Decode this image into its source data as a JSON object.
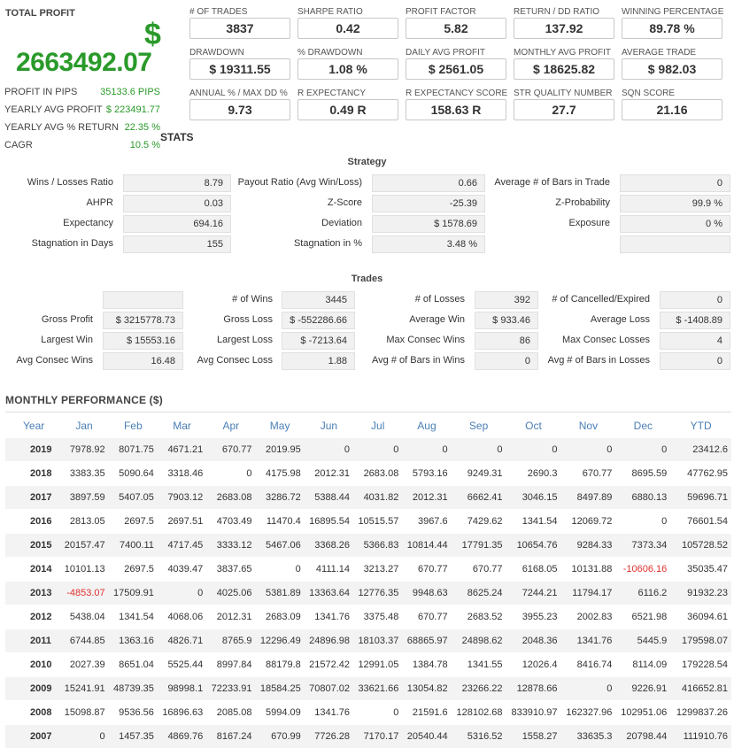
{
  "total_profit": {
    "title": "TOTAL PROFIT",
    "currency_symbol": "$",
    "value": "2663492.07",
    "rows": [
      {
        "label": "PROFIT IN PIPS",
        "value": "35133.6 PIPS"
      },
      {
        "label": "YEARLY AVG PROFIT",
        "value": "$ 223491.77"
      },
      {
        "label": "YEARLY AVG % RETURN",
        "value": "22.35 %"
      },
      {
        "label": "CAGR",
        "value": "10.5 %"
      }
    ]
  },
  "metrics": [
    {
      "label": "# OF TRADES",
      "value": "3837"
    },
    {
      "label": "SHARPE RATIO",
      "value": "0.42"
    },
    {
      "label": "PROFIT FACTOR",
      "value": "5.82"
    },
    {
      "label": "RETURN / DD RATIO",
      "value": "137.92"
    },
    {
      "label": "WINNING PERCENTAGE",
      "value": "89.78 %"
    },
    {
      "label": "DRAWDOWN",
      "value": "$ 19311.55"
    },
    {
      "label": "% DRAWDOWN",
      "value": "1.08 %"
    },
    {
      "label": "DAILY AVG PROFIT",
      "value": "$ 2561.05"
    },
    {
      "label": "MONTHLY AVG PROFIT",
      "value": "$ 18625.82"
    },
    {
      "label": "AVERAGE TRADE",
      "value": "$ 982.03"
    },
    {
      "label": "ANNUAL % / MAX DD %",
      "value": "9.73"
    },
    {
      "label": "R EXPECTANCY",
      "value": "0.49 R"
    },
    {
      "label": "R EXPECTANCY SCORE",
      "value": "158.63 R"
    },
    {
      "label": "STR QUALITY NUMBER",
      "value": "27.7"
    },
    {
      "label": "SQN SCORE",
      "value": "21.16"
    }
  ],
  "stats_heading": "STATS",
  "strategy": {
    "title": "Strategy",
    "rows": [
      [
        {
          "label": "Wins / Losses Ratio",
          "value": "8.79"
        },
        {
          "label": "Payout Ratio (Avg Win/Loss)",
          "value": "0.66"
        },
        {
          "label": "Average # of Bars in Trade",
          "value": "0"
        }
      ],
      [
        {
          "label": "AHPR",
          "value": "0.03"
        },
        {
          "label": "Z-Score",
          "value": "-25.39"
        },
        {
          "label": "Z-Probability",
          "value": "99.9 %"
        }
      ],
      [
        {
          "label": "Expectancy",
          "value": "694.16"
        },
        {
          "label": "Deviation",
          "value": "$ 1578.69"
        },
        {
          "label": "Exposure",
          "value": "0 %"
        }
      ],
      [
        {
          "label": "Stagnation in Days",
          "value": "155"
        },
        {
          "label": "Stagnation in %",
          "value": "3.48 %"
        },
        {
          "label": "",
          "value": ""
        }
      ]
    ]
  },
  "trades": {
    "title": "Trades",
    "rows": [
      [
        {
          "label": "",
          "value": ""
        },
        {
          "label": "# of Wins",
          "value": "3445"
        },
        {
          "label": "# of Losses",
          "value": "392"
        },
        {
          "label": "# of Cancelled/Expired",
          "value": "0"
        }
      ],
      [
        {
          "label": "Gross Profit",
          "value": "$ 3215778.73"
        },
        {
          "label": "Gross Loss",
          "value": "$ -552286.66"
        },
        {
          "label": "Average Win",
          "value": "$ 933.46"
        },
        {
          "label": "Average Loss",
          "value": "$ -1408.89"
        }
      ],
      [
        {
          "label": "Largest Win",
          "value": "$ 15553.16"
        },
        {
          "label": "Largest Loss",
          "value": "$ -7213.64"
        },
        {
          "label": "Max Consec Wins",
          "value": "86"
        },
        {
          "label": "Max Consec Losses",
          "value": "4"
        }
      ],
      [
        {
          "label": "Avg Consec Wins",
          "value": "16.48"
        },
        {
          "label": "Avg Consec Loss",
          "value": "1.88"
        },
        {
          "label": "Avg # of Bars in Wins",
          "value": "0"
        },
        {
          "label": "Avg # of Bars in Losses",
          "value": "0"
        }
      ]
    ]
  },
  "monthly": {
    "title": "MONTHLY PERFORMANCE ($)",
    "headers": [
      "Year",
      "Jan",
      "Feb",
      "Mar",
      "Apr",
      "May",
      "Jun",
      "Jul",
      "Aug",
      "Sep",
      "Oct",
      "Nov",
      "Dec",
      "YTD"
    ],
    "negative_color": "#e03030",
    "rows": [
      [
        "2019",
        "7978.92",
        "8071.75",
        "4671.21",
        "670.77",
        "2019.95",
        "0",
        "0",
        "0",
        "0",
        "0",
        "0",
        "0",
        "23412.6"
      ],
      [
        "2018",
        "3383.35",
        "5090.64",
        "3318.46",
        "0",
        "4175.98",
        "2012.31",
        "2683.08",
        "5793.16",
        "9249.31",
        "2690.3",
        "670.77",
        "8695.59",
        "47762.95"
      ],
      [
        "2017",
        "3897.59",
        "5407.05",
        "7903.12",
        "2683.08",
        "3286.72",
        "5388.44",
        "4031.82",
        "2012.31",
        "6662.41",
        "3046.15",
        "8497.89",
        "6880.13",
        "59696.71"
      ],
      [
        "2016",
        "2813.05",
        "2697.5",
        "2697.51",
        "4703.49",
        "11470.4",
        "16895.54",
        "10515.57",
        "3967.6",
        "7429.62",
        "1341.54",
        "12069.72",
        "0",
        "76601.54"
      ],
      [
        "2015",
        "20157.47",
        "7400.11",
        "4717.45",
        "3333.12",
        "5467.06",
        "3368.26",
        "5366.83",
        "10814.44",
        "17791.35",
        "10654.76",
        "9284.33",
        "7373.34",
        "105728.52"
      ],
      [
        "2014",
        "10101.13",
        "2697.5",
        "4039.47",
        "3837.65",
        "0",
        "4111.14",
        "3213.27",
        "670.77",
        "670.77",
        "6168.05",
        "10131.88",
        "-10606.16",
        "35035.47"
      ],
      [
        "2013",
        "-4853.07",
        "17509.91",
        "0",
        "4025.06",
        "5381.89",
        "13363.64",
        "12776.35",
        "9948.63",
        "8625.24",
        "7244.21",
        "11794.17",
        "6116.2",
        "91932.23"
      ],
      [
        "2012",
        "5438.04",
        "1341.54",
        "4068.06",
        "2012.31",
        "2683.09",
        "1341.76",
        "3375.48",
        "670.77",
        "2683.52",
        "3955.23",
        "2002.83",
        "6521.98",
        "36094.61"
      ],
      [
        "2011",
        "6744.85",
        "1363.16",
        "4826.71",
        "8765.9",
        "12296.49",
        "24896.98",
        "18103.37",
        "68865.97",
        "24898.62",
        "2048.36",
        "1341.76",
        "5445.9",
        "179598.07"
      ],
      [
        "2010",
        "2027.39",
        "8651.04",
        "5525.44",
        "8997.84",
        "88179.8",
        "21572.42",
        "12991.05",
        "1384.78",
        "1341.55",
        "12026.4",
        "8416.74",
        "8114.09",
        "179228.54"
      ],
      [
        "2009",
        "15241.91",
        "48739.35",
        "98998.1",
        "72233.91",
        "18584.25",
        "70807.02",
        "33621.66",
        "13054.82",
        "23266.22",
        "12878.66",
        "0",
        "9226.91",
        "416652.81"
      ],
      [
        "2008",
        "15098.87",
        "9536.56",
        "16896.63",
        "2085.08",
        "5994.09",
        "1341.76",
        "0",
        "21591.6",
        "128102.68",
        "833910.97",
        "162327.96",
        "102951.06",
        "1299837.26"
      ],
      [
        "2007",
        "0",
        "1457.35",
        "4869.76",
        "8167.24",
        "670.99",
        "7726.28",
        "7170.17",
        "20540.44",
        "5316.52",
        "1558.27",
        "33635.3",
        "20798.44",
        "111910.76"
      ]
    ]
  }
}
